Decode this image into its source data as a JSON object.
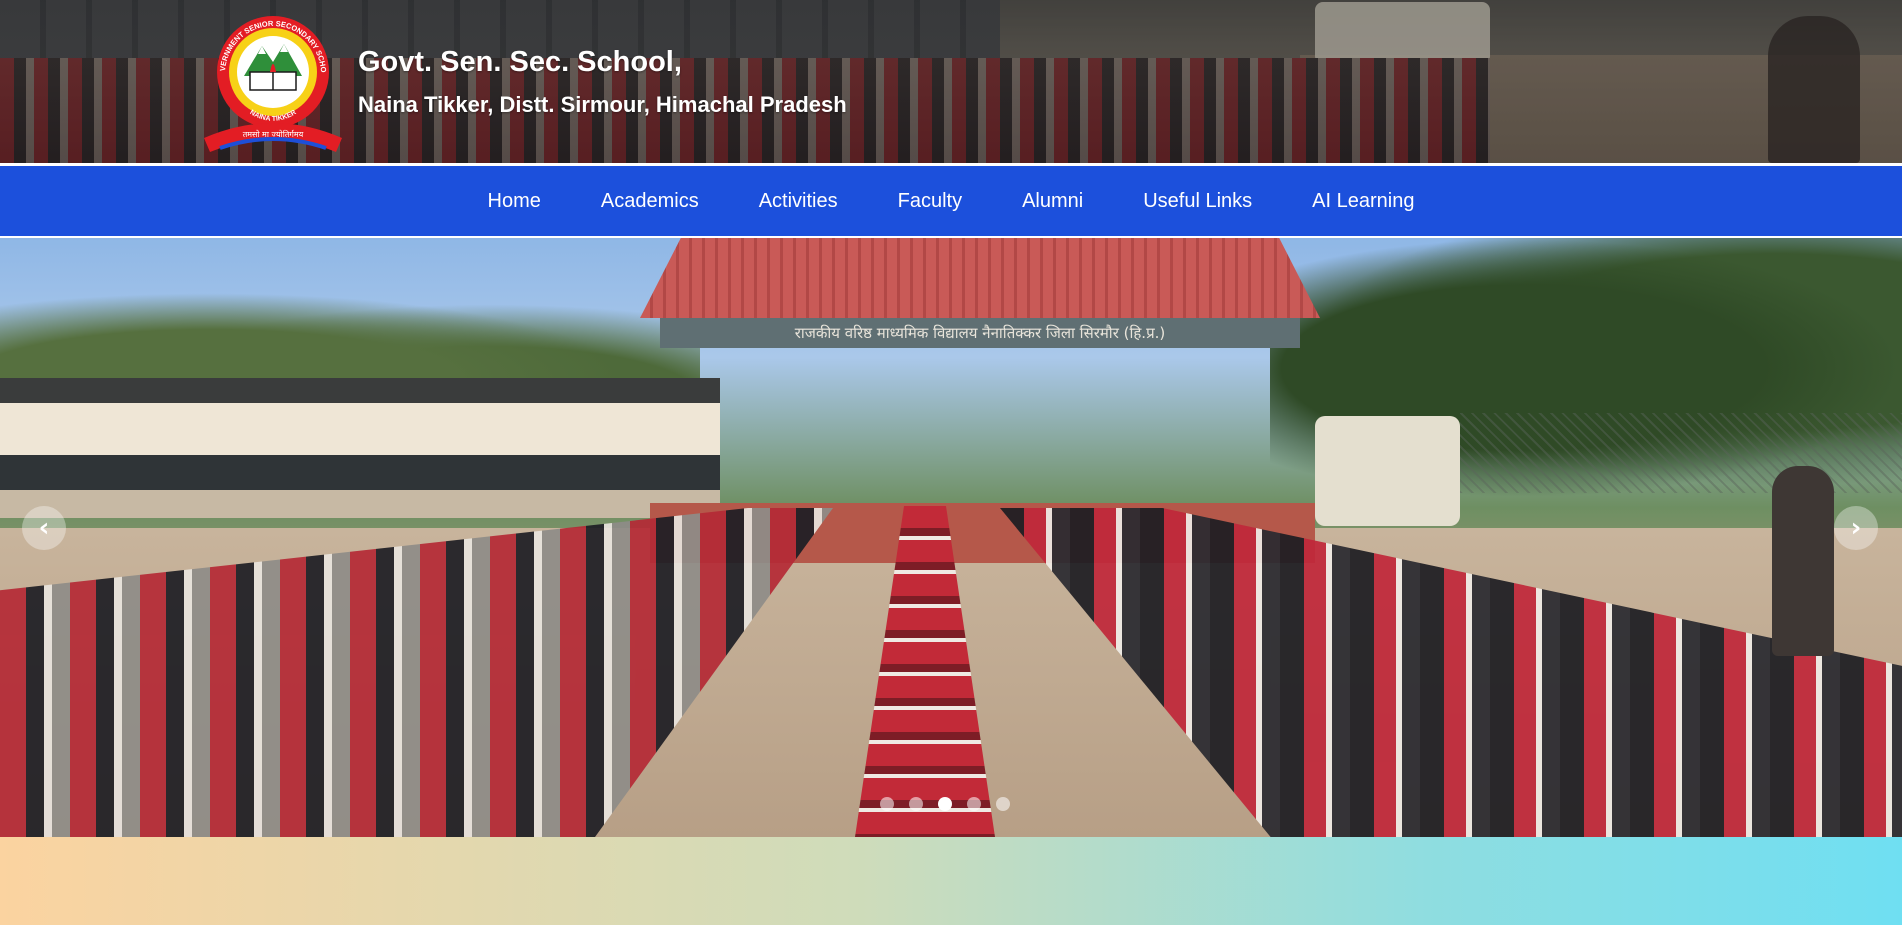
{
  "header": {
    "title": "Govt. Sen. Sec. School,",
    "subtitle": "Naina Tikker, Distt. Sirmour, Himachal Pradesh",
    "logo": {
      "top_text": "GOVERNMENT SENIOR SECONDARY SCHOOL",
      "bottom_text": "NAINA TIKKER",
      "motto": "तमसो मा ज्योतिर्गमय"
    }
  },
  "nav": {
    "items": [
      {
        "label": "Home"
      },
      {
        "label": "Academics"
      },
      {
        "label": "Activities"
      },
      {
        "label": "Faculty"
      },
      {
        "label": "Alumni"
      },
      {
        "label": "Useful Links"
      },
      {
        "label": "AI Learning"
      }
    ]
  },
  "slider": {
    "prev_icon": "chevron-left-icon",
    "next_icon": "chevron-right-icon",
    "prev_glyph": "‹",
    "next_glyph": "›",
    "slide_count": 5,
    "active_index": 2,
    "stage_banner": "राजकीय वरिष्ठ माध्यमिक विद्यालय नैनातिक्कर जिला सिरमौर (हि.प्र.)"
  },
  "colors": {
    "nav_background": "#1c50dc",
    "text": "#ffffff",
    "logo_red": "#e31d24",
    "logo_yellow": "#f7d117"
  }
}
